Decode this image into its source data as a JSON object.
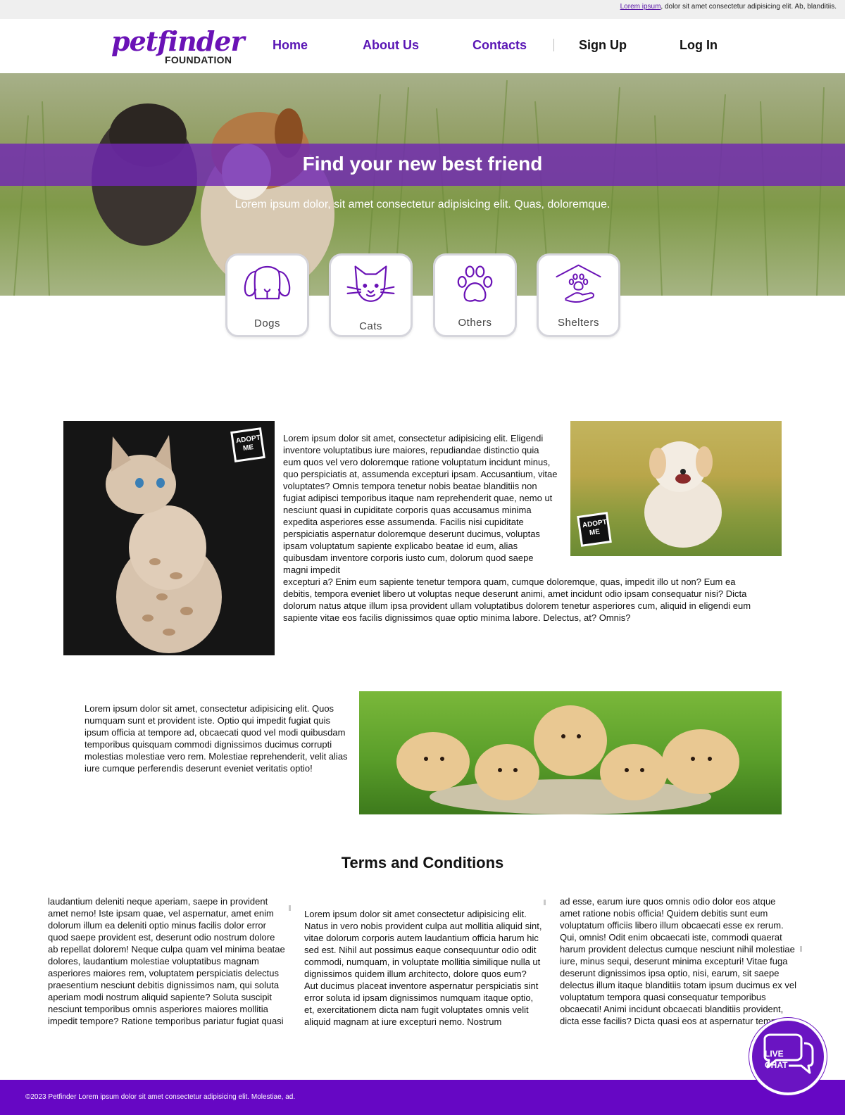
{
  "topbar": {
    "link_text": "Lorem ipsum",
    "rest_text": ", dolor sit amet consectetur adipisicing elit. Ab, blanditiis."
  },
  "brand": {
    "logo_main": "petfinder",
    "logo_sub": "FOUNDATION",
    "accent_color": "#6a12b6",
    "footer_color": "#6607c4"
  },
  "nav": {
    "items": [
      {
        "label": "Home"
      },
      {
        "label": "About Us"
      },
      {
        "label": "Contacts"
      },
      {
        "label": "Sign Up"
      },
      {
        "label": "Log In"
      }
    ]
  },
  "hero": {
    "title": "Find your new best friend",
    "subtitle": "Lorem ipsum dolor, sit amet consectetur adipisicing elit. Quas, doloremque."
  },
  "categories": [
    {
      "label": "Dogs",
      "icon": "dog-icon"
    },
    {
      "label": "Cats",
      "icon": "cat-icon"
    },
    {
      "label": "Others",
      "icon": "paw-icon"
    },
    {
      "label": "Shelters",
      "icon": "shelter-icon"
    }
  ],
  "section1": {
    "badge": "ADOPT ME",
    "text_wrapped": "Lorem ipsum dolor sit amet, consectetur adipisicing elit. Eligendi inventore voluptatibus iure maiores, repudiandae distinctio quia eum quos vel vero doloremque ratione voluptatum incidunt minus, quo perspiciatis at, assumenda excepturi ipsam. Accusantium, vitae voluptates? Omnis tempora tenetur nobis beatae blanditiis non fugiat adipisci temporibus itaque nam reprehenderit quae, nemo ut nesciunt quasi in cupiditate corporis quas accusamus minima expedita asperiores esse assumenda. Facilis nisi cupiditate perspiciatis aspernatur doloremque deserunt ducimus, voluptas ipsam voluptatum sapiente explicabo beatae id eum, alias quibusdam inventore corporis iusto cum, dolorum quod saepe magni impedit",
    "text_full": "excepturi a? Enim eum sapiente tenetur tempora quam, cumque doloremque, quas, impedit illo ut non? Eum ea debitis, tempora eveniet libero ut voluptas neque deserunt animi, amet incidunt odio ipsam consequatur nisi? Dicta dolorum natus atque illum ipsa provident ullam voluptatibus dolorem tenetur asperiores cum, aliquid in eligendi eum sapiente vitae eos facilis dignissimos quae optio minima labore. Delectus, at? Omnis?"
  },
  "section2": {
    "text": "Lorem ipsum dolor sit amet, consectetur adipisicing elit. Quos numquam sunt et provident iste. Optio qui impedit fugiat quis ipsum officia at tempore ad, obcaecati quod vel modi quibusdam temporibus quisquam commodi dignissimos ducimus corrupti molestias molestiae vero rem. Molestiae reprehenderit, velit alias iure cumque perferendis deserunt eveniet veritatis optio!"
  },
  "terms": {
    "title": "Terms and Conditions",
    "col1": "laudantium deleniti neque aperiam, saepe in provident amet nemo! Iste ipsam quae, vel aspernatur, amet enim dolorum illum ea deleniti optio minus facilis dolor error quod saepe provident est, deserunt odio nostrum dolore ab repellat dolorem! Neque culpa quam vel minima beatae dolores, laudantium molestiae voluptatibus magnam asperiores maiores rem, voluptatem perspiciatis delectus praesentium nesciunt debitis dignissimos nam, qui soluta aperiam modi nostrum aliquid sapiente? Soluta suscipit nesciunt temporibus omnis asperiores maiores mollitia impedit tempore? Ratione temporibus pariatur fugiat quasi",
    "col2": "Lorem ipsum dolor sit amet consectetur adipisicing elit. Natus in vero nobis provident culpa aut mollitia aliquid sint, vitae dolorum corporis autem laudantium officia harum hic sed est. Nihil aut possimus eaque consequuntur odio odit commodi, numquam, in voluptate mollitia similique nulla ut dignissimos quidem illum architecto, dolore quos eum? Aut ducimus placeat inventore aspernatur perspiciatis sint error soluta id ipsam dignissimos numquam itaque optio, et, exercitationem dicta nam fugit voluptates omnis velit aliquid magnam at iure excepturi nemo. Nostrum",
    "col3": "ad esse, earum iure quos omnis odio dolor eos atque amet ratione nobis officia! Quidem debitis sunt eum voluptatum officiis libero illum obcaecati esse ex rerum. Qui, omnis! Odit enim obcaecati iste, commodi quaerat harum provident delectus cumque nesciunt nihil molestiae iure, minus sequi, deserunt minima excepturi! Vitae fuga deserunt dignissimos ipsa optio, nisi, earum, sit saepe delectus illum itaque blanditiis totam ipsum ducimus ex vel voluptatum tempora quasi consequatur temporibus obcaecati! Animi incidunt obcaecati blanditiis provident, dicta esse facilis? Dicta quasi eos at aspernatur tempore quam. Repre"
  },
  "footer": {
    "text": "©2023 Petfinder Lorem ipsum dolor sit amet consectetur adipisicing elit. Molestiae, ad."
  },
  "chat": {
    "line1": "LIVE",
    "line2": "CHAT"
  }
}
